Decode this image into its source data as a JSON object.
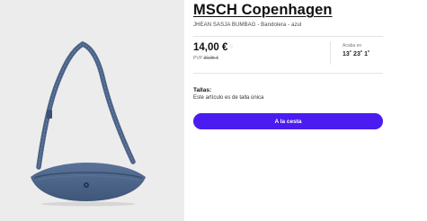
{
  "product": {
    "image_alt": "Bandolera vaquera azul",
    "brand": "MSCH Copenhagen",
    "subtitle": "JHEAN SASJA BUMBAG - Bandolera - azul",
    "price": "14,00 €",
    "rrp_label": "PVP",
    "rrp_value": "39,95 €",
    "countdown_label": "Acaba en",
    "countdown": "13˚ 23˚ 1˚",
    "sizes_label": "Tallas:",
    "sizes_text": "Este artículo es de talla única",
    "cart_button": "A la cesta"
  },
  "colors": {
    "accent": "#4a1cf0",
    "bag_denim": "#4a6286",
    "image_background": "#ececec"
  },
  "icons": {
    "price_info": "info-icon"
  }
}
